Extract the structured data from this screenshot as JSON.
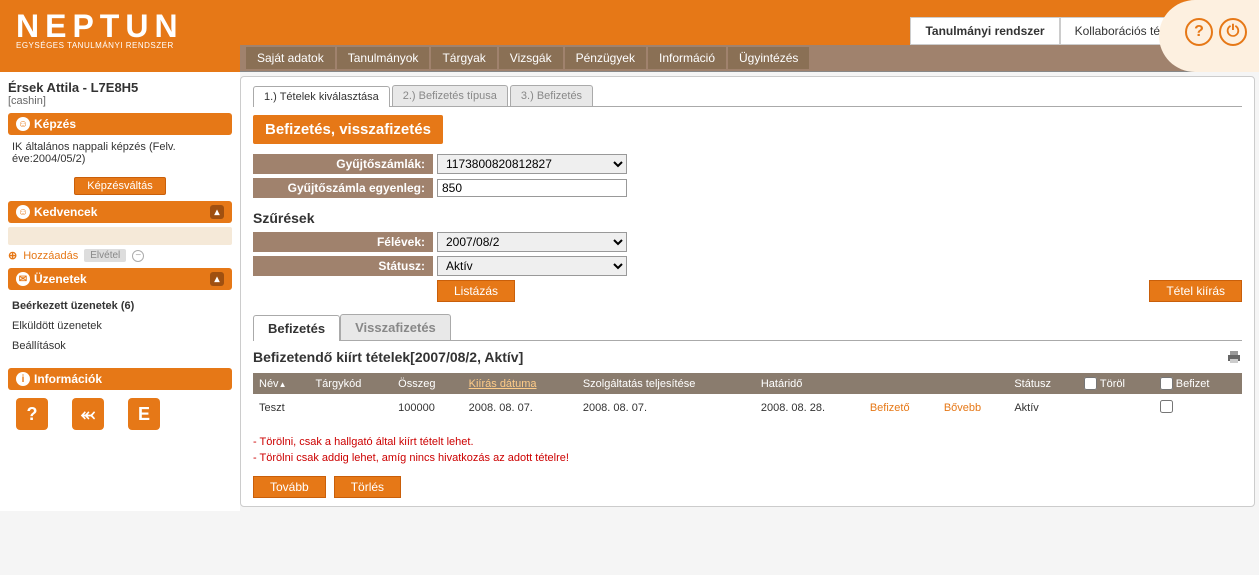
{
  "logo": {
    "title": "NEPTUN",
    "subtitle": "EGYSÉGES TANULMÁNYI RENDSZER"
  },
  "top_tabs": {
    "study": "Tanulmányi rendszer",
    "collab": "Kollaborációs tér"
  },
  "main_menu": [
    "Saját adatok",
    "Tanulmányok",
    "Tárgyak",
    "Vizsgák",
    "Pénzügyek",
    "Információ",
    "Ügyintézés"
  ],
  "user": {
    "name": "Érsek Attila - L7E8H5",
    "role": "[cashin]"
  },
  "sidebar": {
    "training": {
      "header": "Képzés",
      "text": "IK általános nappali képzés (Felv. éve:2004/05/2)",
      "switch_btn": "Képzésváltás"
    },
    "favorites": {
      "header": "Kedvencek",
      "add": "Hozzáadás",
      "remove": "Elvétel"
    },
    "messages": {
      "header": "Üzenetek",
      "inbox": "Beérkezett üzenetek (6)",
      "sent": "Elküldött üzenetek",
      "settings": "Beállítások"
    },
    "info": {
      "header": "Információk"
    }
  },
  "steps": {
    "s1": "1.) Tételek kiválasztása",
    "s2": "2.) Befizetés típusa",
    "s3": "3.) Befizetés"
  },
  "page_title": "Befizetés, visszafizetés",
  "form": {
    "account_label": "Gyűjtőszámlák:",
    "account_value": "1173800820812827",
    "balance_label": "Gyűjtőszámla egyenleg:",
    "balance_value": "850",
    "filters_title": "Szűrések",
    "semester_label": "Félévek:",
    "semester_value": "2007/08/2",
    "status_label": "Státusz:",
    "status_value": "Aktív",
    "list_btn": "Listázás",
    "new_item_btn": "Tétel kiírás"
  },
  "sub_tabs": {
    "pay": "Befizetés",
    "refund": "Visszafizetés"
  },
  "list_title": "Befizetendő kiírt tételek[2007/08/2, Aktív]",
  "columns": {
    "name": "Név",
    "code": "Tárgykód",
    "amount": "Összeg",
    "date": "Kiírás dátuma",
    "service": "Szolgáltatás teljesítése",
    "deadline": "Határidő",
    "status": "Státusz",
    "delete": "Töröl",
    "pay": "Befizet"
  },
  "row": {
    "name": "Teszt",
    "code": "",
    "amount": "100000",
    "date": "2008. 08. 07.",
    "service": "2008. 08. 07.",
    "deadline": "2008. 08. 28.",
    "payer": "Befizető",
    "more": "Bővebb",
    "status": "Aktív"
  },
  "warnings": {
    "l1": "- Törölni, csak a hallgató által kiírt tételt lehet.",
    "l2": "- Törölni csak addig lehet, amíg nincs hivatkozás az adott tételre!"
  },
  "bottom": {
    "next": "Tovább",
    "delete": "Törlés"
  }
}
